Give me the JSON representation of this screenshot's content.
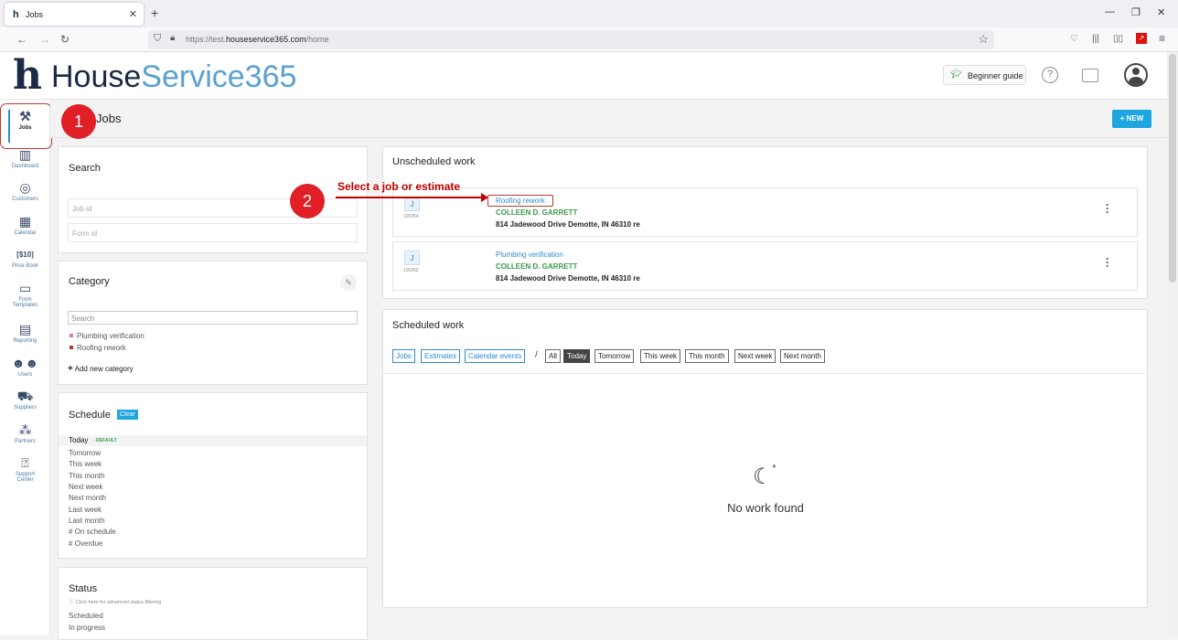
{
  "browser": {
    "tab_title": "Jobs",
    "tab_favicon": "h",
    "url_host": "https://test.",
    "url_domain": "houseservice365.com",
    "url_path": "/home"
  },
  "header": {
    "logo_mark": "h",
    "logo_part1": "House",
    "logo_part2": "Service365",
    "beginner_guide": "Beginner guide"
  },
  "sidebar": {
    "items": [
      {
        "label": "Jobs",
        "icon": "tools-icon"
      },
      {
        "label": "Dashboard",
        "icon": "bar-chart-icon"
      },
      {
        "label": "Customers",
        "icon": "target-icon"
      },
      {
        "label": "Calendar",
        "icon": "calendar-icon"
      },
      {
        "label": "Price Book",
        "icon": "price-tag-icon"
      },
      {
        "label": "Form",
        "label2": "Templates",
        "icon": "form-template-icon"
      },
      {
        "label": "Reporting",
        "icon": "report-icon"
      },
      {
        "label": "Users",
        "icon": "users-icon"
      },
      {
        "label": "Suppliers",
        "icon": "truck-icon"
      },
      {
        "label": "Partners",
        "icon": "network-icon"
      },
      {
        "label": "Support",
        "label2": "Center",
        "icon": "help-box-icon"
      }
    ]
  },
  "page": {
    "title": "Jobs",
    "new_button": "+ NEW"
  },
  "annotations": {
    "step1": "1",
    "step2": "2",
    "callout": "Select a job or estimate"
  },
  "search_panel": {
    "title": "Search",
    "job_id_placeholder": "Job id",
    "form_id_placeholder": "Form id"
  },
  "category_panel": {
    "title": "Category",
    "search_placeholder": "Search",
    "items": [
      {
        "label": "Plumbing verification",
        "color": "#d17ac0"
      },
      {
        "label": "Roofing rework",
        "color": "#b03a2e"
      }
    ],
    "add_new": "Add new category"
  },
  "schedule_panel": {
    "title": "Schedule",
    "clear": "Clear",
    "today": "Today",
    "default_tag": "- DEFAULT",
    "items": [
      "Tomorrow",
      "This week",
      "This month",
      "Next week",
      "Next month",
      "Last week",
      "Last month",
      "# On schedule",
      "# Overdue"
    ]
  },
  "status_panel": {
    "title": "Status",
    "hint": "Click here for advanced status filtering",
    "items": [
      "Scheduled",
      "In progress"
    ]
  },
  "unscheduled": {
    "title": "Unscheduled work",
    "jobs": [
      {
        "badge": "J",
        "number": "100254",
        "title": "Roofing rework",
        "customer": "COLLEEN D. GARRETT",
        "address": "814 Jadewood Drive Demotte, IN 46310 re"
      },
      {
        "badge": "J",
        "number": "100252",
        "title": "Plumbing verification",
        "customer": "COLLEEN D. GARRETT",
        "address": "814 Jadewood Drive Demotte, IN 46310 re"
      }
    ]
  },
  "scheduled": {
    "title": "Scheduled work",
    "type_filters": [
      "Jobs",
      "Estimates",
      "Calendar events"
    ],
    "separator": "/",
    "time_filters": [
      "All",
      "Today",
      "Tomorrow",
      "This week",
      "This month",
      "Next week",
      "Next month"
    ],
    "active_filter": "Today",
    "empty_text": "No work found"
  }
}
